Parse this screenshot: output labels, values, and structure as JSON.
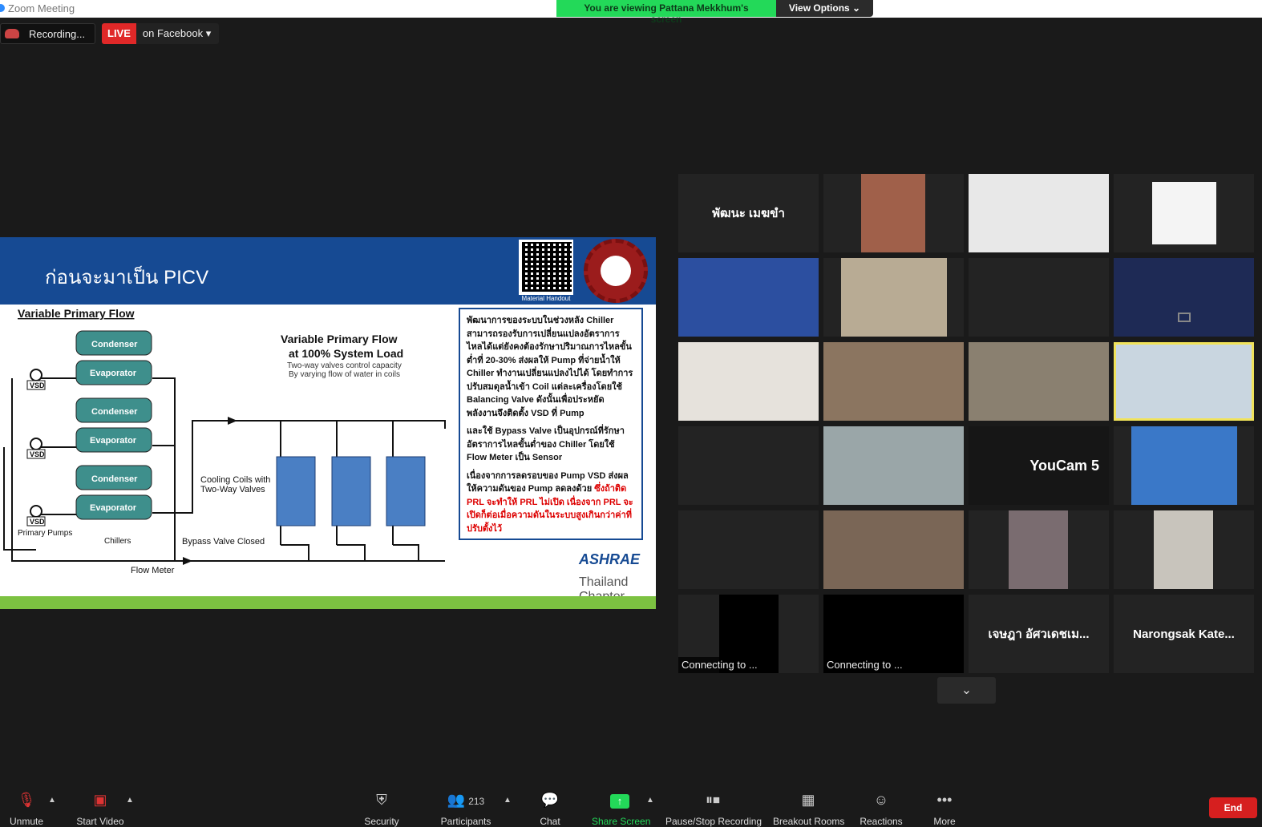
{
  "window": {
    "title": "Zoom Meeting"
  },
  "share_banner": {
    "viewing_text": "You are viewing Pattana Mekkhum's screen",
    "view_options": "View Options ⌄"
  },
  "recording": {
    "label": "Recording..."
  },
  "live": {
    "badge": "LIVE",
    "platform": "on Facebook",
    "caret": "▾"
  },
  "slide": {
    "title": "ก่อนจะมาเป็น PICV",
    "qr_label": "Material Handout",
    "diagram": {
      "heading": "Variable Primary Flow",
      "subheading": "Variable Primary Flow",
      "subheading2": "at 100% System Load",
      "note1": "Two-way valves control capacity",
      "note2": "By varying flow of water in coils",
      "condenser": "Condenser",
      "evaporator": "Evaporator",
      "vsd": "VSD",
      "primary_pumps": "Primary Pumps",
      "chillers": "Chillers",
      "cooling_coils1": "Cooling Coils with",
      "cooling_coils2": "Two-Way Valves",
      "bypass": "Bypass Valve Closed",
      "flow_meter": "Flow Meter"
    },
    "text": {
      "p1": "พัฒนาการของระบบในช่วงหลัง Chiller สามารถรองรับการเปลี่ยนแปลงอัตราการไหลได้แต่ยังคงต้องรักษาปริมาณการไหลขั้นต่ำที่ 20-30% ส่งผลให้ Pump ที่จ่ายน้ำให้ Chiller ทำงานเปลี่ยนแปลงไปได้ โดยทำการปรับสมดุลน้ำเข้า Coil แต่ละเครื่องโดยใช้ Balancing Valve ดังนั้นเพื่อประหยัดพลังงานจึงติดตั้ง VSD ที่ Pump",
      "p2": "และใช้ Bypass Valve เป็นอุปกรณ์ที่รักษาอัตราการไหลขั้นต่ำของ Chiller โดยใช้ Flow Meter เป็น Sensor",
      "p3a": "เนื่องจากการลดรอบของ Pump VSD ส่งผลให้ความดันของ Pump ลดลงด้วย",
      "p3b": "ซึ่งถ้าติด PRL จะทำให้ PRL ไม่เปิด เนื่องจาก PRL จะเปิดก็ต่อเมื่อความดันในระบบสูงเกินกว่าค่าที่ปรับตั้งไว้"
    },
    "ashrae": {
      "name": "ASHRAE",
      "chapter": "Thailand Chapter"
    }
  },
  "participants": {
    "tiles": [
      {
        "name": "พัฒนะ เมฆขำ"
      },
      {
        "name": ""
      },
      {
        "name": ""
      },
      {
        "name": ""
      },
      {
        "name": ""
      },
      {
        "name": ""
      },
      {
        "name": ""
      },
      {
        "name": ""
      },
      {
        "name": ""
      },
      {
        "name": ""
      },
      {
        "name": ""
      },
      {
        "name": ""
      },
      {
        "name": ""
      },
      {
        "name": ""
      },
      {
        "name": "YouCam 5"
      },
      {
        "name": ""
      },
      {
        "name": ""
      },
      {
        "name": ""
      },
      {
        "name": ""
      },
      {
        "name": ""
      },
      {
        "name": "Connecting to ..."
      },
      {
        "name": "Connecting to ..."
      },
      {
        "name": "เจษฎา อัศวเดชเม..."
      },
      {
        "name": "Narongsak Kate..."
      }
    ],
    "more": "⌄"
  },
  "toolbar": {
    "unmute": "Unmute",
    "start_video": "Start Video",
    "security": "Security",
    "participants": "Participants",
    "participant_count": "213",
    "chat": "Chat",
    "share_screen": "Share Screen",
    "pause_recording": "Pause/Stop Recording",
    "breakout": "Breakout Rooms",
    "reactions": "Reactions",
    "more": "More",
    "end": "End"
  },
  "colors": {
    "accent_green": "#23d959",
    "live_red": "#e02828",
    "end_red": "#d61f1f",
    "active_speaker": "#f1e35a"
  }
}
